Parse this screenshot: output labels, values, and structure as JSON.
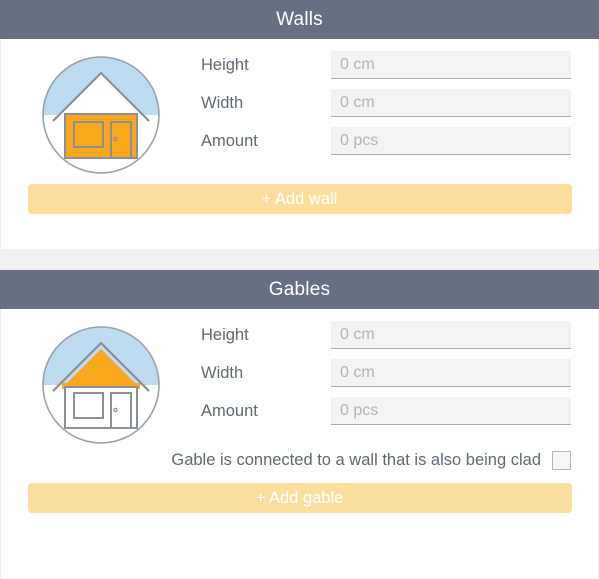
{
  "theme": {
    "header_bg": "#676f83",
    "header_text": "#ffffff",
    "button_bg": "#fbde9d",
    "button_text": "#ffffff",
    "label_text": "#5f6877",
    "input_bg": "#f3f3f3",
    "input_underline": "#a9adb5",
    "placeholder_text": "#b4b4b4",
    "icon_orange": "#f9a81c",
    "icon_sky": "#bedcef",
    "icon_outline": "#8a8f9a",
    "page_bg": "#f0f0f0"
  },
  "panels": [
    {
      "id": "walls",
      "title": "Walls",
      "icon_name": "house-walls-highlighted-icon",
      "fields": [
        {
          "label": "Height",
          "value": "",
          "placeholder": "0 cm"
        },
        {
          "label": "Width",
          "value": "",
          "placeholder": "0 cm"
        },
        {
          "label": "Amount",
          "value": "",
          "placeholder": "0 pcs"
        }
      ],
      "checkbox": null,
      "button_label": "+ Add wall"
    },
    {
      "id": "gables",
      "title": "Gables",
      "icon_name": "house-gable-highlighted-icon",
      "fields": [
        {
          "label": "Height",
          "value": "",
          "placeholder": "0 cm"
        },
        {
          "label": "Width",
          "value": "",
          "placeholder": "0 cm"
        },
        {
          "label": "Amount",
          "value": "",
          "placeholder": "0 pcs"
        }
      ],
      "checkbox": {
        "label": "Gable is connected to a wall that is also being clad",
        "checked": false
      },
      "button_label": "+ Add gable"
    }
  ]
}
